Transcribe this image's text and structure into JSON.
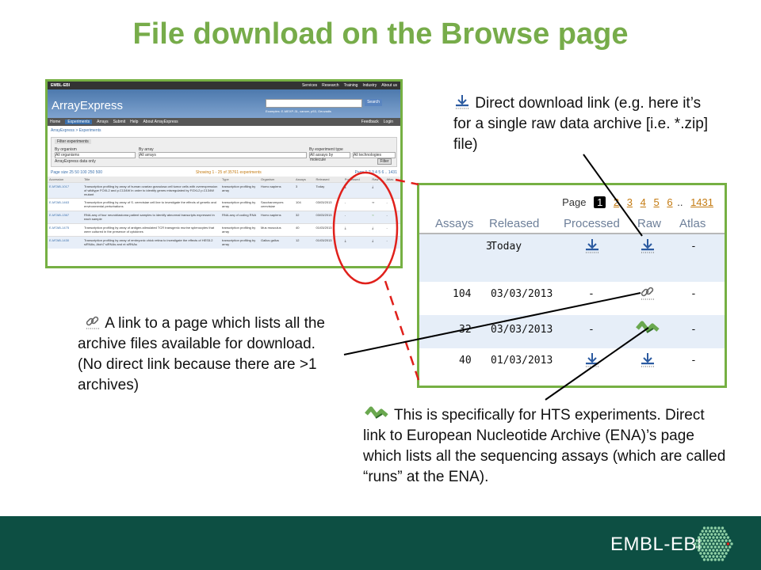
{
  "slide": {
    "title": "File download on the Browse page",
    "caption_download": "Direct download link (e.g. here it’s for a single raw data archive [i.e. *.zip] file)",
    "caption_link": "A link to a page which lists all the archive files available for download. (No direct link because there are >1 archives)",
    "caption_ena": "This is specifically for HTS experiments. Direct link to European Nucleotide Archive (ENA)’s page which lists all the sequencing assays (which are called “runs” at the ENA).",
    "footer_logo": "EMBL-EBI"
  },
  "screenshot": {
    "topbar_brand": "EMBL-EBI",
    "topbar_links": [
      "Services",
      "Research",
      "Training",
      "Industry",
      "About us"
    ],
    "app_title": "ArrayExpress",
    "search_button": "Search",
    "search_examples": "Examples: E-MEXP-31, cancer, p53, Geuvadis",
    "advanced": "Advanced",
    "nav": [
      "Home",
      "Experiments",
      "Arrays",
      "Submit",
      "Help",
      "About ArrayExpress"
    ],
    "nav_right": [
      "Feedback",
      "Login"
    ],
    "breadcrumb": "ArrayExpress > Experiments",
    "filter_title": "Filter experiments",
    "filter_labels": [
      "By organism",
      "By array",
      "By experiment type"
    ],
    "filter_values": [
      "All organisms",
      "All arrays",
      "All assays by molecule",
      "All technologies"
    ],
    "filter_checkbox": "ArrayExpress data only",
    "filter_button": "Filter",
    "page_size": "Page size 25 50 100 250 500",
    "showing": "Showing 1 - 25 of 35761 experiments",
    "pages": "Page 1 2 3 4 5 6 .. 1431",
    "columns": [
      "Accession",
      "Title",
      "Type",
      "Organism",
      "Assays",
      "Released",
      "Processed",
      "Raw",
      "Atlas"
    ],
    "rows": [
      {
        "acc": "E-MTAB-1017",
        "title": "Transcription profiling by array of human ovarian granulosa cell tumor cells with overexpression of wildtype FOXL2 and p.C134W in order to identify genes misregulated by FOXL2 p.C134W mutant",
        "type": "transcription profiling by array",
        "org": "Homo sapiens",
        "assays": "3",
        "rel": "Today"
      },
      {
        "acc": "E-MTAB-1463",
        "title": "Transcription profiling by array of S. cerevisiae cell line to investigate the effects of genetic and environmental perturbations",
        "type": "transcription profiling by array",
        "org": "Saccharomyces cerevisiae",
        "assays": "104",
        "rel": "03/03/2013"
      },
      {
        "acc": "E-MTAB-1367",
        "title": "RNA-seq of four neuroblastoma patient samples to identify abnormal transcripts expressed in each sample",
        "type": "RNA-seq of coding RNA",
        "org": "Homo sapiens",
        "assays": "32",
        "rel": "03/03/2013"
      },
      {
        "acc": "E-MTAB-1475",
        "title": "Transcription profiling by array of antigen-stimulated TCR transgenic murine splenocytes that were cultured in the presence of cytokines",
        "type": "transcription profiling by array",
        "org": "Mus musculus",
        "assays": "40",
        "rel": "01/03/2013"
      },
      {
        "acc": "E-MTAB-1430",
        "title": "Transcription profiling by array of embryonic chick retina to investigate the effects of HES5.2 siRNAs, Atoh7 siRNAs and nt siRNAs",
        "type": "transcription profiling by array",
        "org": "Gallus gallus",
        "assays": "12",
        "rel": "01/03/2013"
      }
    ]
  },
  "zoom": {
    "page_label": "Page",
    "current_page": "1",
    "pages": [
      "2",
      "3",
      "4",
      "5",
      "6",
      "..",
      "1431"
    ],
    "columns": [
      "Assays",
      "Released",
      "Processed",
      "Raw",
      "Atlas"
    ],
    "rows": [
      {
        "assays": "3",
        "released": "Today",
        "processed": "download-icon",
        "raw": "download-icon",
        "atlas": "-"
      },
      {
        "assays": "104",
        "released": "03/03/2013",
        "processed": "-",
        "raw": "link-icon",
        "atlas": "-"
      },
      {
        "assays": "32",
        "released": "03/03/2013",
        "processed": "-",
        "raw": "ena-icon",
        "atlas": "-"
      },
      {
        "assays": "40",
        "released": "01/03/2013",
        "processed": "download-icon",
        "raw": "download-icon",
        "atlas": "-"
      }
    ]
  },
  "colors": {
    "title_green": "#77ac4a",
    "frame_green": "#76b043",
    "footer": "#0d4f43",
    "highlight_red": "#e0201b",
    "link_orange": "#c47b12"
  }
}
